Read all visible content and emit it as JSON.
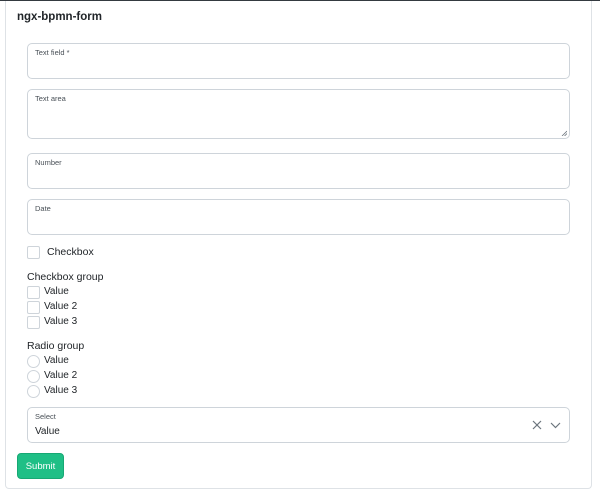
{
  "form": {
    "title": "ngx-bpmn-form",
    "text_field": {
      "label": "Text field *",
      "value": ""
    },
    "text_area": {
      "label": "Text area",
      "value": ""
    },
    "number": {
      "label": "Number",
      "value": ""
    },
    "date": {
      "label": "Date",
      "value": ""
    },
    "checkbox": {
      "label": "Checkbox",
      "checked": false
    },
    "checkbox_group": {
      "label": "Checkbox group",
      "options": [
        "Value",
        "Value 2",
        "Value 3"
      ]
    },
    "radio_group": {
      "label": "Radio group",
      "options": [
        "Value",
        "Value 2",
        "Value 3"
      ]
    },
    "select": {
      "label": "Select",
      "value": "Value"
    },
    "submit_label": "Submit"
  },
  "icons": {
    "clear": "x-icon",
    "dropdown": "chevron-down-icon"
  },
  "colors": {
    "accent": "#1fbf86",
    "border": "#ced4da"
  }
}
